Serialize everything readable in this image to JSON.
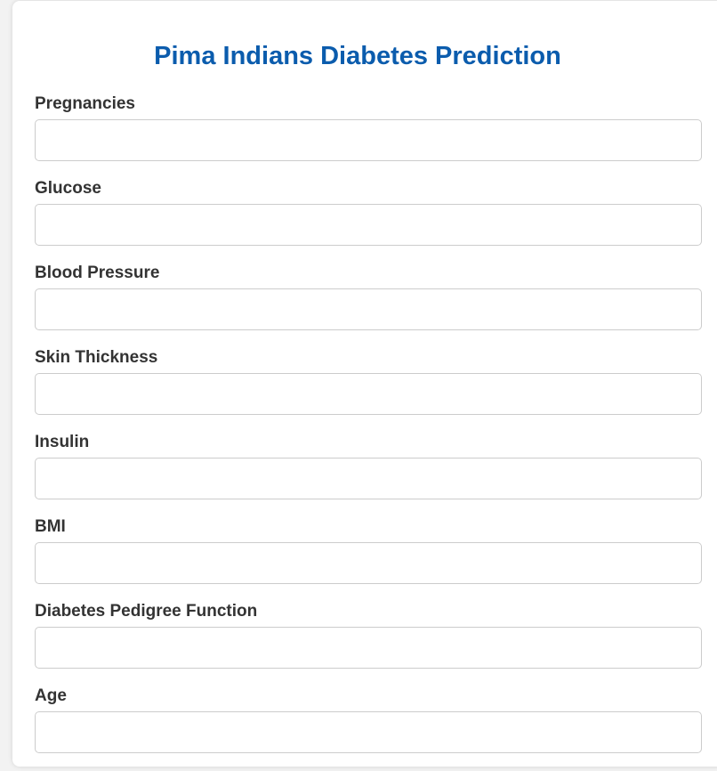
{
  "page": {
    "title": "Pima Indians Diabetes Prediction"
  },
  "form": {
    "fields": [
      {
        "label": "Pregnancies",
        "value": ""
      },
      {
        "label": "Glucose",
        "value": ""
      },
      {
        "label": "Blood Pressure",
        "value": ""
      },
      {
        "label": "Skin Thickness",
        "value": ""
      },
      {
        "label": "Insulin",
        "value": ""
      },
      {
        "label": "BMI",
        "value": ""
      },
      {
        "label": "Diabetes Pedigree Function",
        "value": ""
      },
      {
        "label": "Age",
        "value": ""
      }
    ]
  },
  "colors": {
    "title": "#0b5cad",
    "label": "#333333",
    "input_border": "#cccccc",
    "background": "#f2f2f2"
  }
}
